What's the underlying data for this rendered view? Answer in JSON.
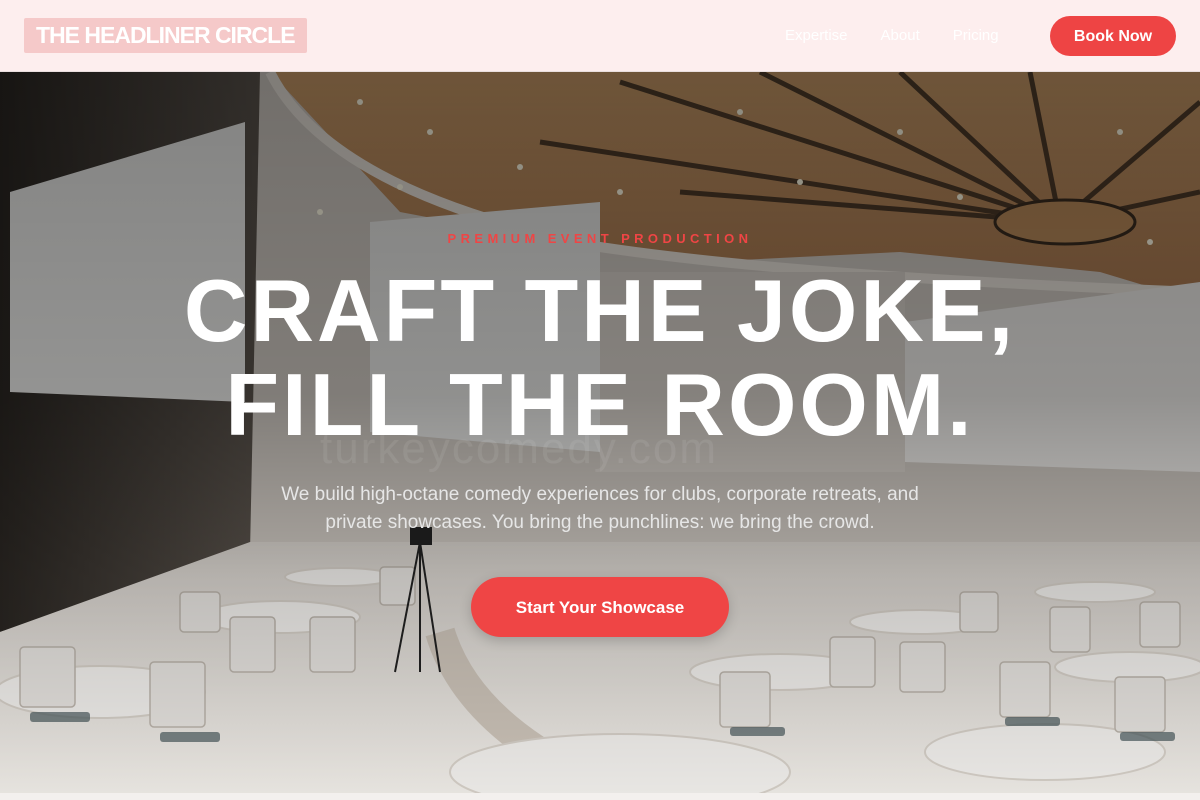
{
  "nav": {
    "logo": "THE HEADLINER CIRCLE",
    "links": [
      "Expertise",
      "About",
      "Pricing"
    ],
    "cta": "Book Now"
  },
  "hero": {
    "eyebrow": "PREMIUM EVENT PRODUCTION",
    "headline_line1": "CRAFT THE JOKE,",
    "headline_line2": "FILL THE ROOM.",
    "subtitle_line1": "We build high-octane comedy experiences for clubs, corporate retreats, and",
    "subtitle_line2": "private showcases. You bring the punchlines: we bring the crowd.",
    "cta": "Start Your Showcase",
    "watermark": "turkeycomedy.com"
  },
  "colors": {
    "accent": "#ef4545",
    "nav_bg": "#fdeeee",
    "logo_bg": "#f5c9c9"
  }
}
